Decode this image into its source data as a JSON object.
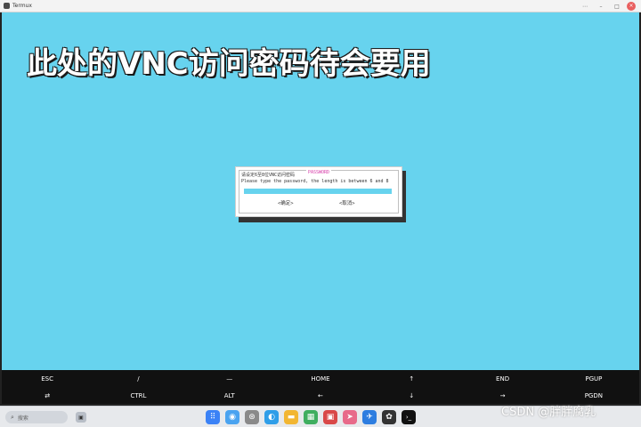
{
  "window": {
    "title": "Termux",
    "controls": {
      "more": "⋯",
      "minimize": "–",
      "maximize": "□",
      "close": "×"
    }
  },
  "caption": "此处的VNC访问密码待会要用",
  "dialog": {
    "title": "PASSWORD",
    "prompt_cn": "请设定6至8位VNC访问密码",
    "prompt_en": "Please type the password, the length is between 6 and 8",
    "password_value": "",
    "input_color": "#67d3ee",
    "ok_label": "<确定>",
    "cancel_label": "<取消>"
  },
  "extra_keys": [
    [
      "ESC",
      "/",
      "—",
      "HOME",
      "↑",
      "END",
      "PGUP"
    ],
    [
      "⇄",
      "CTRL",
      "ALT",
      "←",
      "↓",
      "→",
      "PGDN"
    ]
  ],
  "taskbar": {
    "search_placeholder": "搜索",
    "search_icon": "search-icon",
    "widget_icon": "widgets-icon",
    "apps": [
      {
        "name": "app-launcher-icon",
        "glyph": "⠿",
        "color": "#3b82f6"
      },
      {
        "name": "file-manager-icon",
        "glyph": "◉",
        "color": "#4aa3f0"
      },
      {
        "name": "browser-icon",
        "glyph": "⊛",
        "color": "#8a8a8a"
      },
      {
        "name": "music-icon",
        "glyph": "◐",
        "color": "#2f9ee8"
      },
      {
        "name": "folder-icon",
        "glyph": "▬",
        "color": "#f2b632"
      },
      {
        "name": "gallery-icon",
        "glyph": "▦",
        "color": "#3fae5f"
      },
      {
        "name": "store-icon",
        "glyph": "▣",
        "color": "#d94848"
      },
      {
        "name": "send-icon",
        "glyph": "➤",
        "color": "#e86a8a"
      },
      {
        "name": "transfer-icon",
        "glyph": "✈",
        "color": "#2d7de0"
      },
      {
        "name": "qq-icon",
        "glyph": "✿",
        "color": "#333333"
      },
      {
        "name": "terminal-icon",
        "glyph": "›_",
        "color": "#111111"
      }
    ]
  },
  "watermark": "CSDN @胖胖腐乳"
}
